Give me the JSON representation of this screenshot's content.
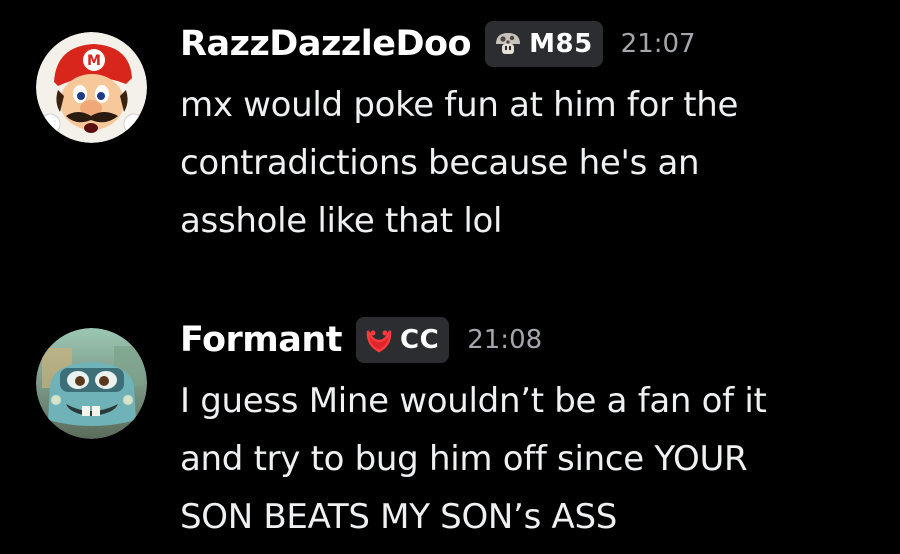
{
  "messages": [
    {
      "username": "RazzDazzleDoo",
      "tag": {
        "icon": "mushroom-icon",
        "label": "M85"
      },
      "timestamp": "21:07",
      "avatar": "mario-avatar",
      "lines": [
        "mx would poke fun at him for the",
        "contradictions because he's an",
        "asshole like that lol"
      ]
    },
    {
      "username": "Formant",
      "tag": {
        "icon": "red-ring-icon",
        "label": "CC"
      },
      "timestamp": "21:08",
      "avatar": "tow-truck-avatar",
      "lines": [
        "I guess Mine wouldn’t be a fan of it",
        "and try to bug him off since YOUR",
        "SON BEATS MY SON’s ASS"
      ]
    }
  ],
  "colors": {
    "background": "#000000",
    "tag_background": "#2b2d31",
    "timestamp": "#a3a6aa",
    "text": "#eef0f2"
  }
}
